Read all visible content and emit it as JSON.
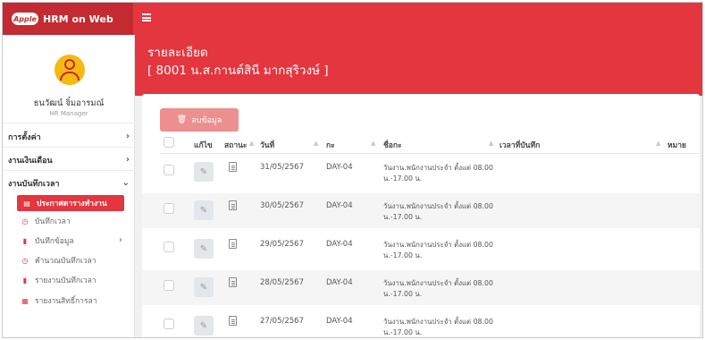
{
  "app": {
    "brand_logo_text": "Apple",
    "title": "HRM on Web"
  },
  "sidebar": {
    "user_name": "ธนวัฒน์ จิ๋มอารมณ์",
    "user_role": "HR Manager",
    "menu": [
      {
        "label": "การตั้งค่า",
        "chevron": "›"
      },
      {
        "label": "งานเงินเดือน",
        "chevron": "›"
      },
      {
        "label": "งานบันทึกเวลา",
        "chevron": "⌄"
      }
    ],
    "submenu": [
      {
        "label": "ประกาศตารางทำงาน",
        "icon": "calendar-icon",
        "glyph": "▤",
        "active": true
      },
      {
        "label": "บันทึกเวลา",
        "icon": "clock-icon",
        "glyph": "◷",
        "active": false
      },
      {
        "label": "บันทึกข้อมูล",
        "icon": "file-icon",
        "glyph": "▮",
        "active": false,
        "chevron": "›"
      },
      {
        "label": "คำนวณบันทึกเวลา",
        "icon": "clock-icon",
        "glyph": "◷",
        "active": false
      },
      {
        "label": "รายงานบันทึกเวลา",
        "icon": "file-icon",
        "glyph": "▮",
        "active": false
      },
      {
        "label": "รายงานสิทธิ์การลา",
        "icon": "table-icon",
        "glyph": "▦",
        "active": false
      }
    ]
  },
  "header": {
    "title": "รายละเอียด",
    "subtitle": "[ 8001 น.ส.กานต์สินี มากสุริวงษ์ ]"
  },
  "toolbar": {
    "delete_label": "ลบข้อมูล",
    "delete_icon": "🗑"
  },
  "table": {
    "columns": [
      "แก้ไข",
      "สถานะ",
      "วันที่",
      "กะ",
      "ชื่อกะ",
      "เวลาที่บันทึก",
      "หมาย"
    ],
    "sort_glyph": "▲",
    "edit_glyph": "✎",
    "rows": [
      {
        "date": "31/05/2567",
        "shift": "DAY-04",
        "desc": "วันงาน.พนักงานประจำ ตั้งแต่ 08.00 น.-17.00 น."
      },
      {
        "date": "30/05/2567",
        "shift": "DAY-04",
        "desc": "วันงาน.พนักงานประจำ ตั้งแต่ 08.00 น.-17.00 น."
      },
      {
        "date": "29/05/2567",
        "shift": "DAY-04",
        "desc": "วันงาน.พนักงานประจำ ตั้งแต่ 08.00 น.-17.00 น."
      },
      {
        "date": "28/05/2567",
        "shift": "DAY-04",
        "desc": "วันงาน.พนักงานประจำ ตั้งแต่ 08.00 น.-17.00 น."
      },
      {
        "date": "27/05/2567",
        "shift": "DAY-04",
        "desc": "วันงาน.พนักงานประจำ ตั้งแต่ 08.00 น.-17.00 น."
      }
    ]
  },
  "colors": {
    "brand_red": "#e3363e",
    "brand_red_dark": "#c42a31",
    "delete_button": "#ee8f8f",
    "avatar": "#f6b812"
  }
}
